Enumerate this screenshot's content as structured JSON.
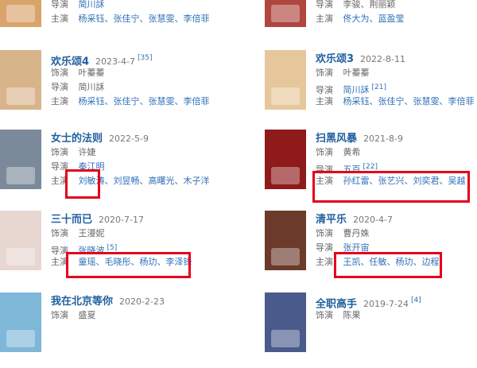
{
  "labels": {
    "dir": "导演",
    "role": "饰演",
    "cast": "主演"
  },
  "accent_link": "#2f6fb7",
  "title_color": "#1f5f9e",
  "highlight_color": "#e4001b",
  "cards": [
    {
      "title": "",
      "date": "",
      "ref": "",
      "director": "简川訸",
      "cast": [
        "杨采钰",
        "张佳宁",
        "张慧雯",
        "李倍菲"
      ],
      "poster": "#d9a36a"
    },
    {
      "title": "",
      "date": "",
      "ref": "",
      "director": "李骏、荆丽颖",
      "cast": [
        "佟大为",
        "蓝盈莹"
      ],
      "poster": "#b0463f"
    },
    {
      "title": "欢乐颂4",
      "date": "2023-4-7",
      "ref": "[35]",
      "role": "叶蓁蓁",
      "director": "简川訸",
      "cast": [
        "杨采钰",
        "张佳宁",
        "张慧雯",
        "李倍菲"
      ],
      "poster": "#d8b48a"
    },
    {
      "title": "欢乐颂3",
      "date": "2022-8-11",
      "ref": "",
      "role": "叶蓁蓁",
      "director": "简川訸",
      "director_ref": "[21]",
      "cast": [
        "杨采钰",
        "张佳宁",
        "张慧雯",
        "李倍菲"
      ],
      "poster": "#e6c79c"
    },
    {
      "title": "女士的法则",
      "date": "2022-5-9",
      "ref": "",
      "role": "许婕",
      "director": "秦江明",
      "cast": [
        "刘敏涛",
        "刘昱畅",
        "高曙光",
        "木子洋"
      ],
      "poster": "#7a8a9a"
    },
    {
      "title": "扫黑风暴",
      "date": "2021-8-9",
      "ref": "",
      "role": "黄希",
      "director": "五百",
      "director_ref": "[22]",
      "cast": [
        "孙红雷",
        "张艺兴",
        "刘奕君",
        "吴越"
      ],
      "poster": "#8e1a1a"
    },
    {
      "title": "三十而已",
      "date": "2020-7-17",
      "ref": "",
      "role": "王漫妮",
      "director": "张晓波",
      "director_ref": "[5]",
      "cast": [
        "童瑶",
        "毛晓彤",
        "杨玏",
        "李泽锋"
      ],
      "poster": "#e8d6d0"
    },
    {
      "title": "清平乐",
      "date": "2020-4-7",
      "ref": "",
      "role": "曹丹姝",
      "director": "张开宙",
      "cast": [
        "王凯",
        "任敏",
        "杨玏",
        "边程"
      ],
      "poster": "#6b3a2a"
    },
    {
      "title": "我在北京等你",
      "date": "2020-2-23",
      "ref": "",
      "role": "盛夏",
      "poster": "#7fb7d9"
    },
    {
      "title": "全职高手",
      "date": "2019-7-24",
      "ref": "[4]",
      "role": "陈果",
      "poster": "#4a5a8a"
    }
  ]
}
